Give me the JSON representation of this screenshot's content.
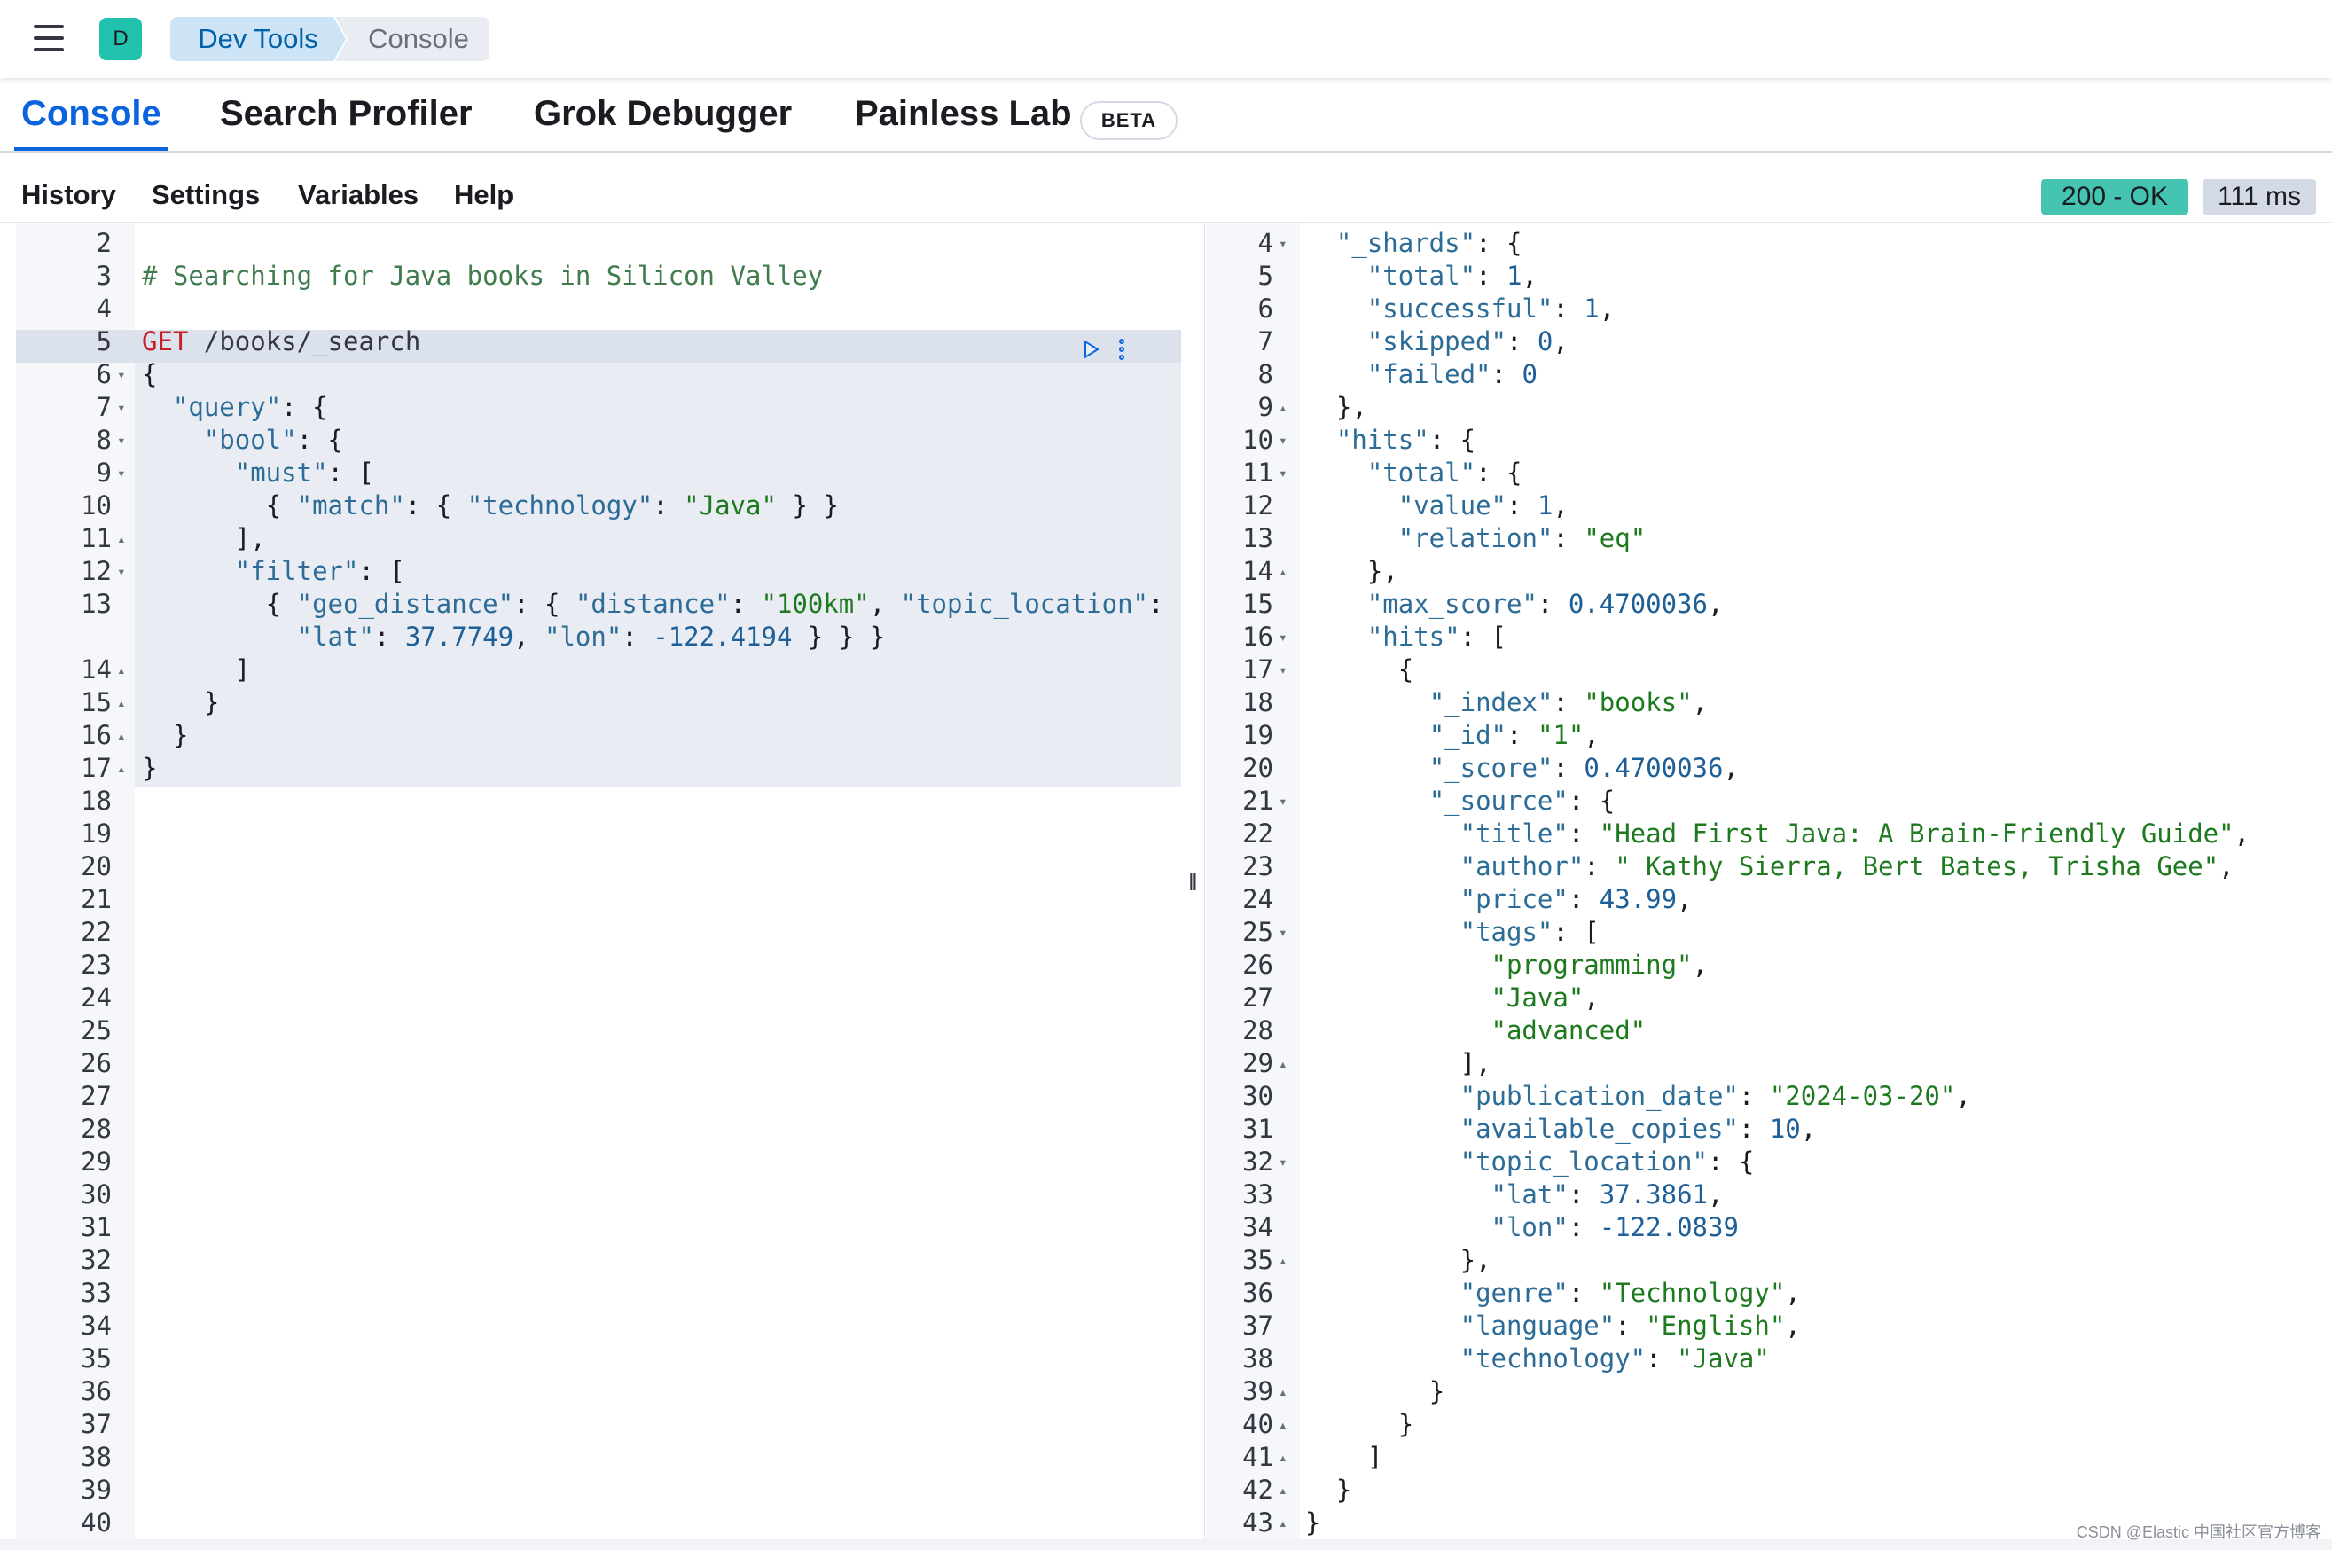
{
  "header": {
    "avatar_letter": "D",
    "breadcrumbs": [
      "Dev Tools",
      "Console"
    ]
  },
  "tabs": [
    {
      "label": "Console",
      "active": true
    },
    {
      "label": "Search Profiler",
      "active": false
    },
    {
      "label": "Grok Debugger",
      "active": false
    },
    {
      "label": "Painless Lab",
      "active": false
    }
  ],
  "beta_badge": "BETA",
  "toolbar": {
    "items": [
      "History",
      "Settings",
      "Variables",
      "Help"
    ],
    "status": "200 - OK",
    "timing": "111 ms"
  },
  "request_editor": {
    "first_line_number": 2,
    "lines": [
      {
        "text": "",
        "fold": ""
      },
      {
        "text": "# Searching for Java books in Silicon Valley",
        "fold": ""
      },
      {
        "text": "",
        "fold": ""
      },
      {
        "text": "GET /books/_search",
        "fold": ""
      },
      {
        "text": "{",
        "fold": "▾"
      },
      {
        "text": "  \"query\": {",
        "fold": "▾"
      },
      {
        "text": "    \"bool\": {",
        "fold": "▾"
      },
      {
        "text": "      \"must\": [",
        "fold": "▾"
      },
      {
        "text": "        { \"match\": { \"technology\": \"Java\" } }",
        "fold": ""
      },
      {
        "text": "      ],",
        "fold": "▴"
      },
      {
        "text": "      \"filter\": [",
        "fold": "▾"
      },
      {
        "text": "        { \"geo_distance\": { \"distance\": \"100km\", \"topic_location\": {",
        "fold": ""
      },
      {
        "text": "          \"lat\": 37.7749, \"lon\": -122.4194 } } }",
        "fold": "",
        "wrapped": true
      },
      {
        "text": "      ]",
        "fold": "▴"
      },
      {
        "text": "    }",
        "fold": "▴"
      },
      {
        "text": "  }",
        "fold": "▴"
      },
      {
        "text": "}",
        "fold": "▴"
      },
      {
        "text": "",
        "fold": ""
      },
      {
        "text": "",
        "fold": ""
      },
      {
        "text": "",
        "fold": ""
      },
      {
        "text": "",
        "fold": ""
      },
      {
        "text": "",
        "fold": ""
      },
      {
        "text": "",
        "fold": ""
      },
      {
        "text": "",
        "fold": ""
      },
      {
        "text": "",
        "fold": ""
      },
      {
        "text": "",
        "fold": ""
      },
      {
        "text": "",
        "fold": ""
      },
      {
        "text": "",
        "fold": ""
      },
      {
        "text": "",
        "fold": ""
      },
      {
        "text": "",
        "fold": ""
      },
      {
        "text": "",
        "fold": ""
      },
      {
        "text": "",
        "fold": ""
      },
      {
        "text": "",
        "fold": ""
      },
      {
        "text": "",
        "fold": ""
      },
      {
        "text": "",
        "fold": ""
      },
      {
        "text": "",
        "fold": ""
      },
      {
        "text": "",
        "fold": ""
      },
      {
        "text": "",
        "fold": ""
      },
      {
        "text": "",
        "fold": ""
      },
      {
        "text": "",
        "fold": ""
      }
    ]
  },
  "response_editor": {
    "first_line_number": 4,
    "lines": [
      {
        "text": "  \"_shards\": {",
        "fold": "▾"
      },
      {
        "text": "    \"total\": 1,",
        "fold": ""
      },
      {
        "text": "    \"successful\": 1,",
        "fold": ""
      },
      {
        "text": "    \"skipped\": 0,",
        "fold": ""
      },
      {
        "text": "    \"failed\": 0",
        "fold": ""
      },
      {
        "text": "  },",
        "fold": "▴"
      },
      {
        "text": "  \"hits\": {",
        "fold": "▾"
      },
      {
        "text": "    \"total\": {",
        "fold": "▾"
      },
      {
        "text": "      \"value\": 1,",
        "fold": ""
      },
      {
        "text": "      \"relation\": \"eq\"",
        "fold": ""
      },
      {
        "text": "    },",
        "fold": "▴"
      },
      {
        "text": "    \"max_score\": 0.4700036,",
        "fold": ""
      },
      {
        "text": "    \"hits\": [",
        "fold": "▾"
      },
      {
        "text": "      {",
        "fold": "▾"
      },
      {
        "text": "        \"_index\": \"books\",",
        "fold": ""
      },
      {
        "text": "        \"_id\": \"1\",",
        "fold": ""
      },
      {
        "text": "        \"_score\": 0.4700036,",
        "fold": ""
      },
      {
        "text": "        \"_source\": {",
        "fold": "▾"
      },
      {
        "text": "          \"title\": \"Head First Java: A Brain-Friendly Guide\",",
        "fold": ""
      },
      {
        "text": "          \"author\": \" Kathy Sierra, Bert Bates, Trisha Gee\",",
        "fold": ""
      },
      {
        "text": "          \"price\": 43.99,",
        "fold": ""
      },
      {
        "text": "          \"tags\": [",
        "fold": "▾"
      },
      {
        "text": "            \"programming\",",
        "fold": ""
      },
      {
        "text": "            \"Java\",",
        "fold": ""
      },
      {
        "text": "            \"advanced\"",
        "fold": ""
      },
      {
        "text": "          ],",
        "fold": "▴"
      },
      {
        "text": "          \"publication_date\": \"2024-03-20\",",
        "fold": ""
      },
      {
        "text": "          \"available_copies\": 10,",
        "fold": ""
      },
      {
        "text": "          \"topic_location\": {",
        "fold": "▾"
      },
      {
        "text": "            \"lat\": 37.3861,",
        "fold": ""
      },
      {
        "text": "            \"lon\": -122.0839",
        "fold": ""
      },
      {
        "text": "          },",
        "fold": "▴"
      },
      {
        "text": "          \"genre\": \"Technology\",",
        "fold": ""
      },
      {
        "text": "          \"language\": \"English\",",
        "fold": ""
      },
      {
        "text": "          \"technology\": \"Java\"",
        "fold": ""
      },
      {
        "text": "        }",
        "fold": "▴"
      },
      {
        "text": "      }",
        "fold": "▴"
      },
      {
        "text": "    ]",
        "fold": "▴"
      },
      {
        "text": "  }",
        "fold": "▴"
      },
      {
        "text": "}",
        "fold": "▴"
      }
    ]
  },
  "watermark": "CSDN @Elastic 中国社区官方博客",
  "colors": {
    "accent": "#0b64dd",
    "status_ok": "#44c4b1",
    "avatar": "#20c1ad"
  }
}
